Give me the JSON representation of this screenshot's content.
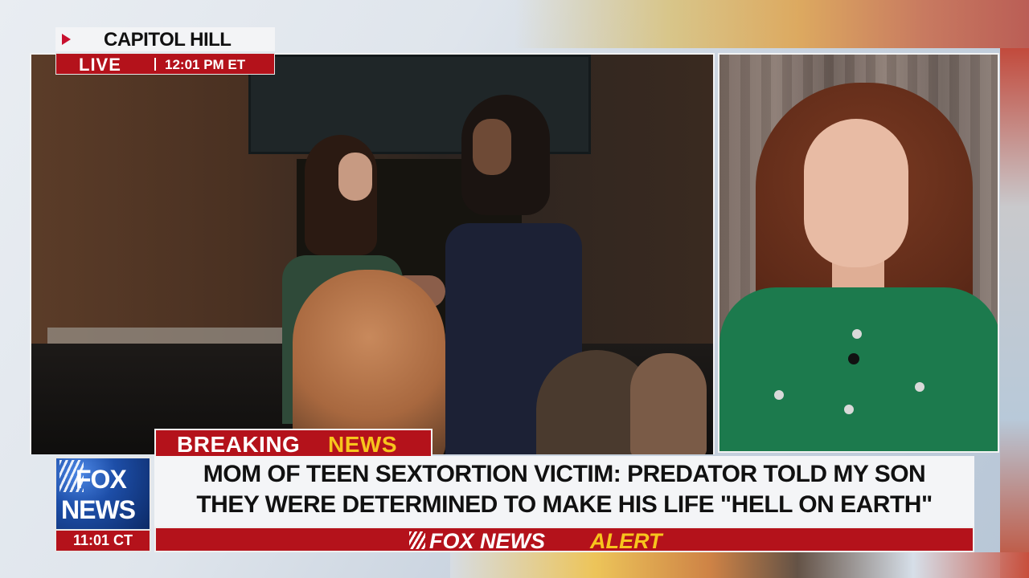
{
  "location": {
    "place": "CAPITOL HILL",
    "live_label": "LIVE",
    "live_time": "12:01 PM ET"
  },
  "banner": {
    "breaking_word": "BREAKING",
    "news_word": "NEWS",
    "headline_line1": "MOM OF TEEN SEXTORTION VICTIM: PREDATOR TOLD MY SON",
    "headline_line2": "THEY WERE DETERMINED TO MAKE HIS LIFE \"HELL ON EARTH\"",
    "alert_white": "FOX NEWS",
    "alert_yellow": "ALERT"
  },
  "logo": {
    "line1": "FOX",
    "line2": "NEWS",
    "clock": "11:01 CT"
  },
  "colors": {
    "brand_red": "#b4121b",
    "alert_yellow": "#f7c51d",
    "logo_blue": "#0e3277"
  }
}
